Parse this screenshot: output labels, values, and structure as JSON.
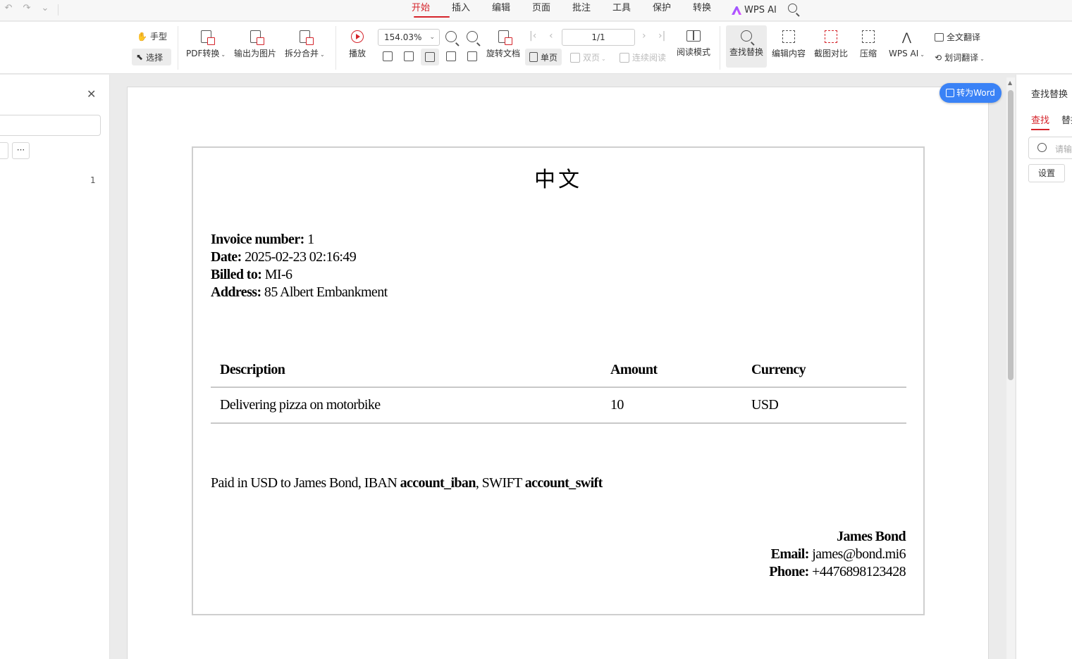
{
  "menubar": {
    "quick_access": [
      "↶",
      "↷",
      "⌄"
    ],
    "tabs": [
      "开始",
      "插入",
      "编辑",
      "页面",
      "批注",
      "工具",
      "保护",
      "转换"
    ],
    "active_tab": "开始",
    "ai_label": "WPS AI"
  },
  "toolbar": {
    "hand": "手型",
    "select": "选择",
    "pdf_convert": "PDF转换",
    "export_image": "输出为图片",
    "split_merge": "拆分合并",
    "play": "播放",
    "zoom_value": "154.03%",
    "page_value": "1/1",
    "rotate_doc": "旋转文档",
    "single_page": "单页",
    "double_page": "双页",
    "continuous": "连续阅读",
    "reading_mode": "阅读模式",
    "find_replace": "查找替换",
    "edit_content": "编辑内容",
    "screenshot_compare": "截图对比",
    "compress": "压缩",
    "wps_ai": "WPS AI",
    "full_translate": "全文翻译",
    "word_translate": "划词翻译"
  },
  "left_panel": {
    "close": "✕",
    "more": "···",
    "page_number": "1"
  },
  "convert_button": "转为Word",
  "invoice": {
    "title": "中文",
    "invoice_number_label": "Invoice number:",
    "invoice_number": "1",
    "date_label": "Date:",
    "date": "2025-02-23 02:16:49",
    "billed_to_label": "Billed to:",
    "billed_to": "MI-6",
    "address_label": "Address:",
    "address": "85 Albert Embankment",
    "table": {
      "headers": [
        "Description",
        "Amount",
        "Currency"
      ],
      "rows": [
        [
          "Delivering pizza on motorbike",
          "10",
          "USD"
        ]
      ]
    },
    "paid_prefix": "Paid in USD to James Bond, IBAN ",
    "paid_iban": "account_iban",
    "paid_mid": ", SWIFT ",
    "paid_swift": "account_swift",
    "signer": "James Bond",
    "email_label": "Email:",
    "email": "james@bond.mi6",
    "phone_label": "Phone:",
    "phone": "+4476898123428"
  },
  "right_panel": {
    "title": "查找替换",
    "tab_find": "查找",
    "tab_replace": "替换",
    "search_placeholder": "请输入",
    "settings": "设置"
  }
}
